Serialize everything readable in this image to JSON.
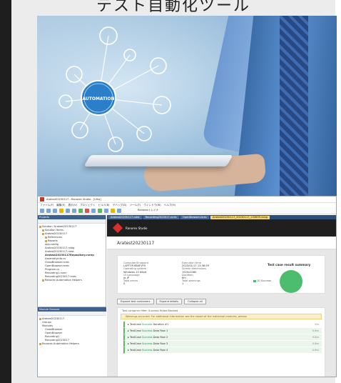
{
  "heading": {
    "text": "テスト自動化ツール"
  },
  "hero": {
    "center_label": "AUTOMATION"
  },
  "app": {
    "window_title": "Aratest20230117 - Ranorex Studio - [Ulha]",
    "menu": [
      "ファイル(F)",
      "編集(E)",
      "表示(V)",
      "プロジェクト",
      "ビルド(B)",
      "デバッグ(D)",
      "ツール(T)",
      "ウィンドウ(W)",
      "ヘルプ(H)"
    ],
    "toolbar_right": "Ranorexトレイナ",
    "projects_panel": {
      "title": "Projects",
      "tree": [
        "Solution 'Aratest20230117'",
        "Solution Items",
        "Aratest20230117",
        "References",
        "Reports",
        "app.config",
        "Aratest20230117.rxlog",
        "Aratest20230117.rxtst",
        "Aratest20230117Repository.rxrep",
        "AssemblyInfo.cs",
        "CloseBrowser.rxrec",
        "OpenBrowser.rxrec",
        "Program.cs",
        "Recording1.rxrec",
        "Recording2023017.rxrec",
        "Ranorex Automation Helpers"
      ]
    },
    "module_panel": {
      "title": "Module Browser",
      "tree": [
        "Aratest20230117",
        "Groups",
        "Modules",
        "CloseBrowser",
        "OpenBrowser",
        "Recording1",
        "Recording2023017",
        "Ranorex Automation Helpers"
      ]
    },
    "tabs": [
      "Aratest20230117.rxtst",
      "Recording2023017.rxrec",
      "OpenBrowser.rxrec",
      "Aratest20230117_20230117_133659.rxlog"
    ],
    "banner_title": "Ranorex Studio",
    "report_title": "Aratest20230117",
    "summary": {
      "left": [
        {
          "label": "Computer/Endpoint",
          "value": "LAPTOP-6B4FVF9"
        },
        {
          "label": "Operating system",
          "value": "Windows 10 64bit"
        },
        {
          "label": "UI Language",
          "value": "ja-JP"
        },
        {
          "label": "Total errors",
          "value": "0"
        }
      ],
      "right": [
        {
          "label": "Execution time",
          "value": "2023/01/17 13:36:59"
        },
        {
          "label": "Screen dimensions",
          "value": "1920x1080"
        },
        {
          "label": "Duration",
          "value": "6m"
        },
        {
          "label": "Total warnings",
          "value": "1"
        }
      ],
      "chart_title": "Test case result summary",
      "legend": "10 Success"
    },
    "buttons": [
      "Expand test containers",
      "Expand details",
      "Collapse all"
    ],
    "filter": "Test container filter:  Success  Failed  Blocked",
    "warning": "Warnings occurred. For additional information see the report of the individual modules, please.",
    "test_cases": [
      {
        "name": "TestCase",
        "tag": "Success",
        "iter": "Iteration #1",
        "dur": "5m"
      },
      {
        "name": "TestCase",
        "tag": "Success",
        "iter": "Data Row 1",
        "dur": "0.8m"
      },
      {
        "name": "TestCase",
        "tag": "Success",
        "iter": "Data Row 2",
        "dur": "0.8m"
      },
      {
        "name": "TestCase",
        "tag": "Success",
        "iter": "Data Row 3",
        "dur": "0.8m"
      },
      {
        "name": "TestCase",
        "tag": "Success",
        "iter": "Data Row 4",
        "dur": "0.8m"
      }
    ],
    "colors": {
      "accent": "#2d4e7a",
      "success": "#4cbd6e",
      "warning_bg": "#fcefc7"
    }
  }
}
